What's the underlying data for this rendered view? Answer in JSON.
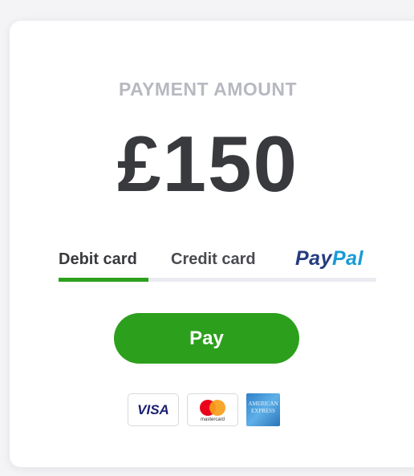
{
  "payment": {
    "label": "PAYMENT AMOUNT",
    "amount": "£150"
  },
  "tabs": {
    "debit": "Debit card",
    "credit": "Credit card",
    "paypal_part1": "Pay",
    "paypal_part2": "Pal",
    "selected": "Debit card"
  },
  "pay_button": {
    "label": "Pay"
  },
  "card_logos": {
    "visa": "VISA",
    "mastercard": "mastercard",
    "amex": "AMERICAN EXPRESS"
  },
  "colors": {
    "accent_green": "#2ca01c",
    "text_dark": "#393a3d",
    "label_gray": "#b7b9c0",
    "paypal_dark": "#253b80",
    "paypal_light": "#179bd7"
  }
}
